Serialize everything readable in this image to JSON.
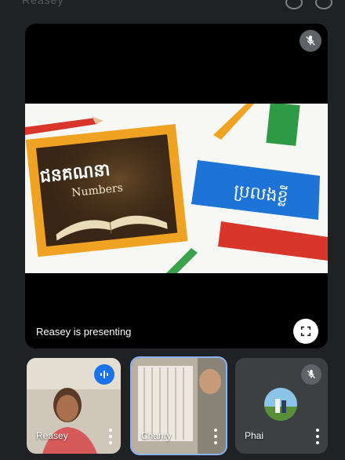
{
  "top_bar": {
    "faded_text": "Reasey"
  },
  "main_tile": {
    "presenting_label": "Reasey is presenting",
    "mic_state": "muted",
    "slide": {
      "board_title": "ជនគណនា",
      "board_subtitle": "Numbers",
      "banner_text": "ប្រលងខ្លី"
    }
  },
  "participants": [
    {
      "name": "Reasey",
      "status": "speaking"
    },
    {
      "name": "Chanry",
      "status": "active"
    },
    {
      "name": "Phai",
      "status": "muted"
    }
  ],
  "icons": {
    "mic_off": "mic-off-icon",
    "speaking": "audio-wave-icon",
    "fullscreen": "fullscreen-icon",
    "more": "more-vert-icon"
  },
  "colors": {
    "background": "#202124",
    "tile": "#3c4043",
    "accent": "#1a73e8",
    "active_border": "#8ab4f8"
  }
}
